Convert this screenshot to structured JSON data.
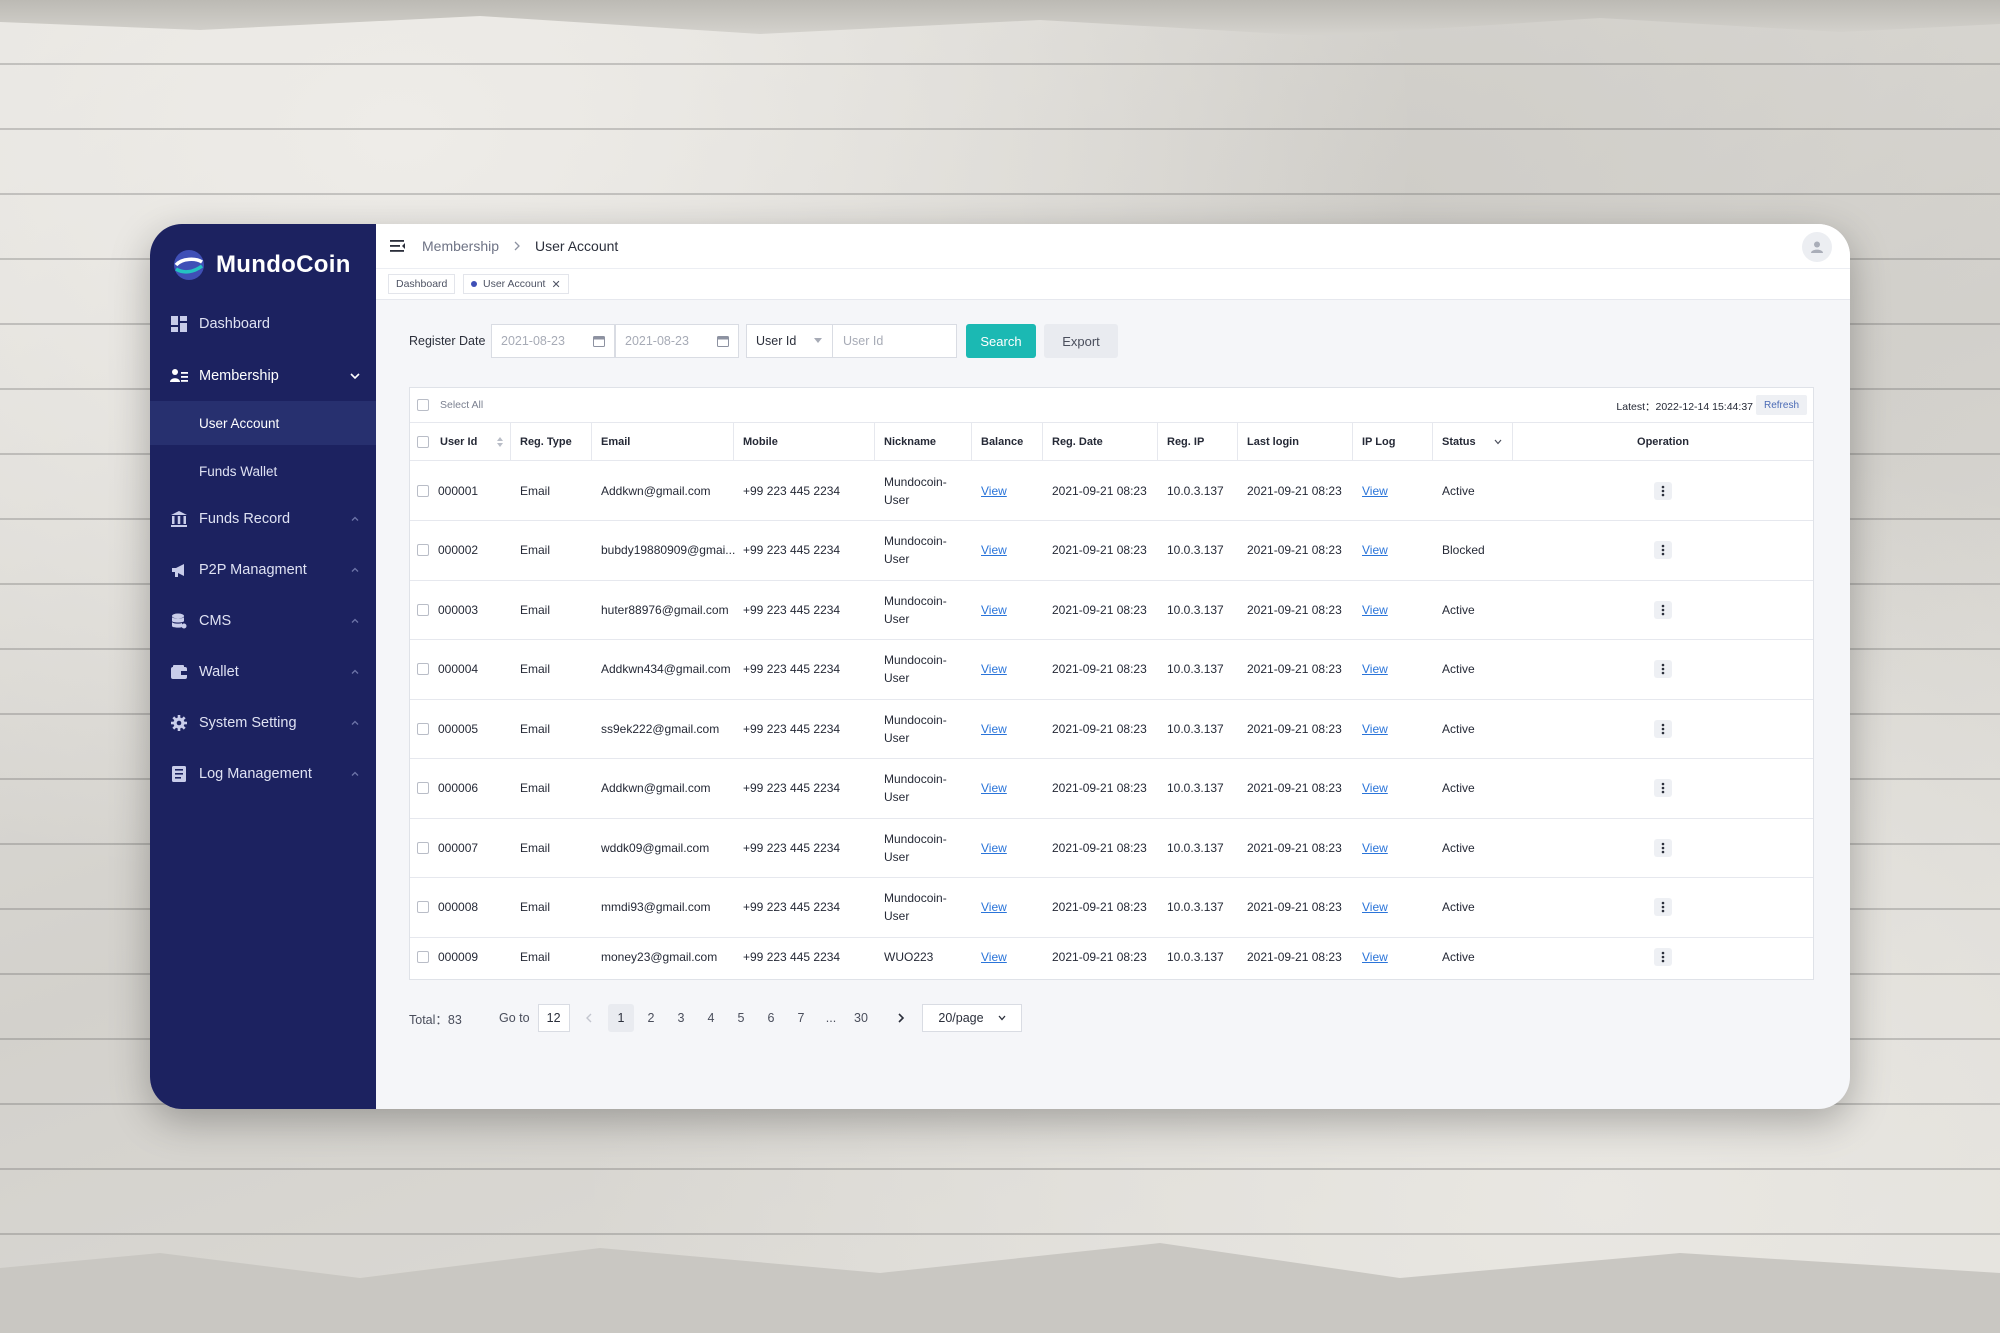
{
  "brand": {
    "name": "MundoCoin"
  },
  "sidebar": {
    "items": [
      {
        "label": "Dashboard",
        "icon": "dashboard-icon"
      },
      {
        "label": "Membership",
        "icon": "members-icon"
      },
      {
        "label": "Funds Record",
        "icon": "bank-icon"
      },
      {
        "label": "P2P Managment",
        "icon": "megaphone-icon"
      },
      {
        "label": "CMS",
        "icon": "database-icon"
      },
      {
        "label": "Wallet",
        "icon": "wallet-icon"
      },
      {
        "label": "System Setting",
        "icon": "gear-icon"
      },
      {
        "label": "Log Management",
        "icon": "log-icon"
      }
    ],
    "subitems": [
      {
        "label": "User Account",
        "active": true
      },
      {
        "label": "Funds Wallet",
        "active": false
      }
    ]
  },
  "header": {
    "breadcrumb": [
      "Membership",
      "User Account"
    ],
    "tabs": [
      "Dashboard",
      "User Account"
    ]
  },
  "filters": {
    "label": "Register Date",
    "date_from": "2021-08-23",
    "date_to": "2021-08-23",
    "field_select": "User Id",
    "field_placeholder": "User Id",
    "search_label": "Search",
    "export_label": "Export"
  },
  "table": {
    "select_all": "Select All",
    "latest": "Latest：2022-12-14 15:44:37",
    "refresh": "Refresh",
    "columns": [
      "User Id",
      "Reg. Type",
      "Email",
      "Mobile",
      "Nickname",
      "Balance",
      "Reg. Date",
      "Reg. IP",
      "Last login",
      "IP Log",
      "Status",
      "Operation"
    ],
    "rows": [
      {
        "id": "000001",
        "type": "Email",
        "email": "Addkwn@gmail.com",
        "mobile": "+99 223 445 2234",
        "nick": "Mundocoin-User",
        "balance": "View",
        "reg_date": "2021-09-21 08:23",
        "ip": "10.0.3.137",
        "last": "2021-09-21 08:23",
        "iplog": "View",
        "status": "Active"
      },
      {
        "id": "000002",
        "type": "Email",
        "email": "bubdy19880909@gmai...",
        "mobile": "+99 223 445 2234",
        "nick": "Mundocoin-User",
        "balance": "View",
        "reg_date": "2021-09-21 08:23",
        "ip": "10.0.3.137",
        "last": "2021-09-21 08:23",
        "iplog": "View",
        "status": "Blocked"
      },
      {
        "id": "000003",
        "type": "Email",
        "email": "huter88976@gmail.com",
        "mobile": "+99 223 445 2234",
        "nick": "Mundocoin-User",
        "balance": "View",
        "reg_date": "2021-09-21 08:23",
        "ip": "10.0.3.137",
        "last": "2021-09-21 08:23",
        "iplog": "View",
        "status": "Active"
      },
      {
        "id": "000004",
        "type": "Email",
        "email": "Addkwn434@gmail.com",
        "mobile": "+99 223 445 2234",
        "nick": "Mundocoin-User",
        "balance": "View",
        "reg_date": "2021-09-21 08:23",
        "ip": "10.0.3.137",
        "last": "2021-09-21 08:23",
        "iplog": "View",
        "status": "Active"
      },
      {
        "id": "000005",
        "type": "Email",
        "email": "ss9ek222@gmail.com",
        "mobile": "+99 223 445 2234",
        "nick": "Mundocoin-User",
        "balance": "View",
        "reg_date": "2021-09-21 08:23",
        "ip": "10.0.3.137",
        "last": "2021-09-21 08:23",
        "iplog": "View",
        "status": "Active"
      },
      {
        "id": "000006",
        "type": "Email",
        "email": "Addkwn@gmail.com",
        "mobile": "+99 223 445 2234",
        "nick": "Mundocoin-User",
        "balance": "View",
        "reg_date": "2021-09-21 08:23",
        "ip": "10.0.3.137",
        "last": "2021-09-21 08:23",
        "iplog": "View",
        "status": "Active"
      },
      {
        "id": "000007",
        "type": "Email",
        "email": "wddk09@gmail.com",
        "mobile": "+99 223 445 2234",
        "nick": "Mundocoin-User",
        "balance": "View",
        "reg_date": "2021-09-21 08:23",
        "ip": "10.0.3.137",
        "last": "2021-09-21 08:23",
        "iplog": "View",
        "status": "Active"
      },
      {
        "id": "000008",
        "type": "Email",
        "email": "mmdi93@gmail.com",
        "mobile": "+99 223 445 2234",
        "nick": "Mundocoin-User",
        "balance": "View",
        "reg_date": "2021-09-21 08:23",
        "ip": "10.0.3.137",
        "last": "2021-09-21 08:23",
        "iplog": "View",
        "status": "Active"
      },
      {
        "id": "000009",
        "type": "Email",
        "email": "money23@gmail.com",
        "mobile": "+99 223 445 2234",
        "nick": "WUO223",
        "balance": "View",
        "reg_date": "2021-09-21 08:23",
        "ip": "10.0.3.137",
        "last": "2021-09-21 08:23",
        "iplog": "View",
        "status": "Active"
      }
    ]
  },
  "pagination": {
    "total": "Total：83",
    "goto_label": "Go to",
    "goto_value": "12",
    "pages": [
      "1",
      "2",
      "3",
      "4",
      "5",
      "6",
      "7",
      "...",
      "30"
    ],
    "current": "1",
    "page_size": "20/page"
  },
  "colors": {
    "sidebar": "#1c2260",
    "accent": "#1bb9b3",
    "link": "#2a74d9"
  }
}
